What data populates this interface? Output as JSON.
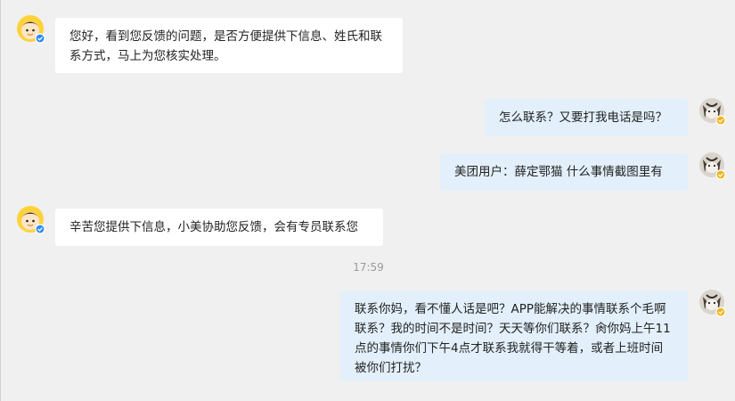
{
  "colors": {
    "background": "#f0f0f0",
    "incoming_bubble": "#ffffff",
    "outgoing_bubble": "#e3f0fb",
    "agent_badge": "#2b8cf0",
    "user_badge": "#f2b318",
    "timestamp": "#9a9a9a"
  },
  "messages": [
    {
      "sender": "agent",
      "avatar_icon": "agent-avatar-icon",
      "text": "您好，看到您反馈的问题，是否方便提供下信息、姓氏和联系方式，马上为您核实处理。"
    },
    {
      "sender": "user",
      "avatar_icon": "cat-avatar-icon",
      "text": "怎么联系？又要打我电话是吗？"
    },
    {
      "sender": "user",
      "avatar_icon": "cat-avatar-icon",
      "text": "美团用户：薛定鄂猫  什么事情截图里有"
    },
    {
      "sender": "agent",
      "avatar_icon": "agent-avatar-icon",
      "text": "辛苦您提供下信息，小美协助您反馈，会有专员联系您"
    },
    {
      "sender": "user",
      "avatar_icon": "cat-avatar-icon",
      "text": "联系你妈，看不懂人话是吧？APP能解决的事情联系个毛啊联系？我的时间不是时间？天天等你们联系？肏你妈上午11点的事情你们下午4点才联系我就得干等着，或者上班时间被你们打扰？"
    }
  ],
  "timestamp": "17:59"
}
